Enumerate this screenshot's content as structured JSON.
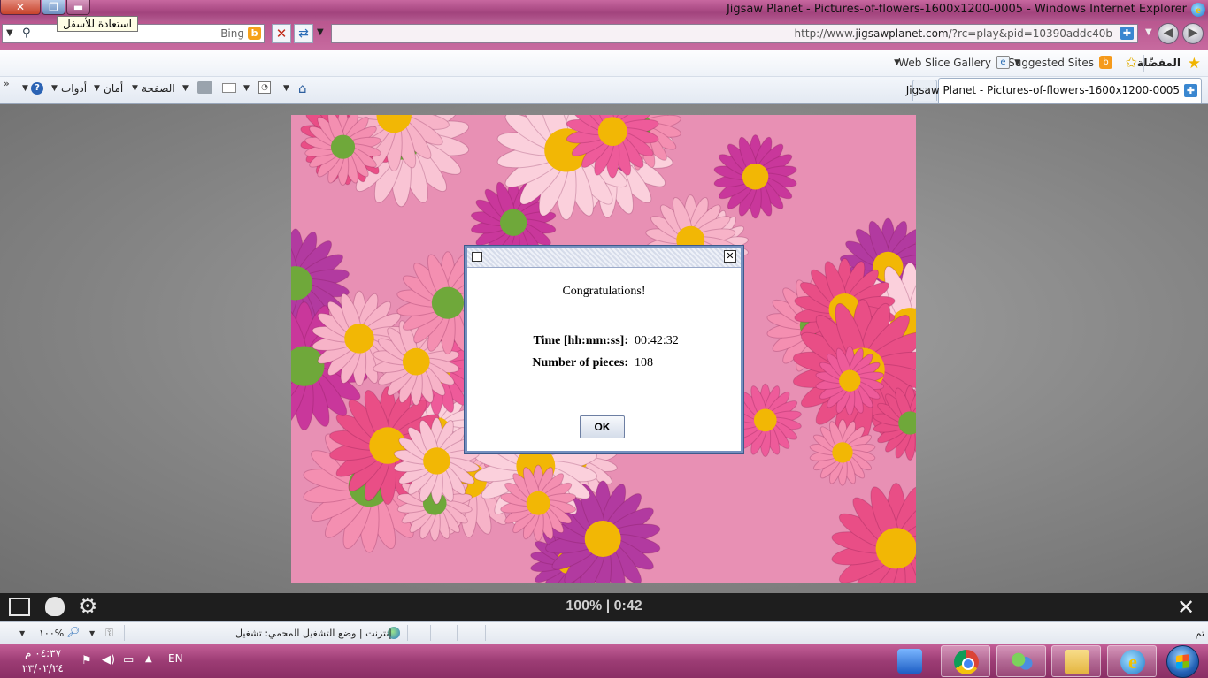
{
  "window": {
    "title": "Jigsaw Planet - Pictures-of-flowers-1600x1200-0005 - Windows Internet Explorer",
    "close_glyph": "✕",
    "restore_glyph": "❐",
    "minimize_glyph": "▬",
    "tooltip": "استعادة للأسفل"
  },
  "search": {
    "placeholder": "Bing",
    "provider_icon": "bing-icon"
  },
  "address": {
    "url_prefix": "http://www.",
    "url_domain": "jigsawplanet.com",
    "url_rest": "/?rc=play&pid=10390addc40b"
  },
  "favorites_bar": {
    "favorites_label": "المفضّلة",
    "suggested_sites_label": "Suggested Sites",
    "web_slice_label": "Web Slice Gallery"
  },
  "command_bar": {
    "tools_label": "أدوات",
    "safety_label": "أمان",
    "page_label": "الصفحة"
  },
  "tab": {
    "label": "Jigsaw Planet - Pictures-of-flowers-1600x1200-0005"
  },
  "dialog": {
    "heading": "Congratulations!",
    "time_label": "Time [hh:mm:ss]:",
    "time_value": "00:42:32",
    "pieces_label": "Number of pieces:",
    "pieces_value": "108",
    "ok_label": "OK"
  },
  "game_bar": {
    "progress_text": "100% | 0:42"
  },
  "status_bar": {
    "done_text": "تم",
    "zone_text": "إنترنت | وضع التشغيل المحمي: تشغيل",
    "zoom_text": "١٠٠%"
  },
  "taskbar": {
    "time": "٠٤:٣٧ م",
    "date": "٢٣/٠٢/٢٤",
    "language": "EN"
  },
  "colors": {
    "title_bar": "#b3568c",
    "content_background": "#8a8a8a",
    "dialog_border": "#7590bf",
    "game_bar": "#1e1e1e",
    "taskbar": "#9c3c74"
  }
}
